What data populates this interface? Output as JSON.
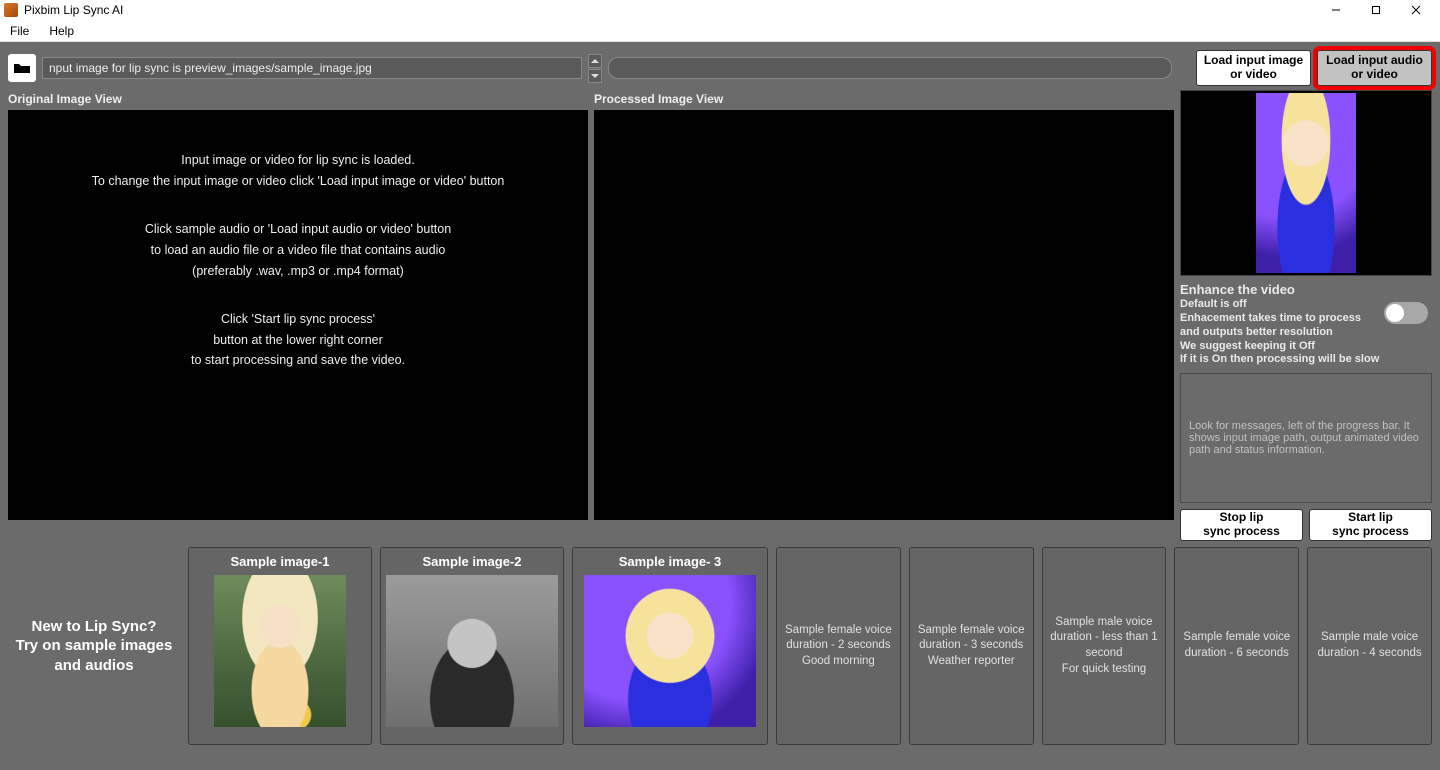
{
  "titlebar": {
    "title": "Pixbim Lip Sync AI"
  },
  "menu": {
    "file": "File",
    "help": "Help"
  },
  "path_input": {
    "value": "nput image for lip sync is preview_images/sample_image.jpg"
  },
  "buttons": {
    "load_image": "Load input image\nor video",
    "load_audio": "Load input audio\nor video",
    "stop": "Stop lip\nsync process",
    "start": "Start lip\nsync process"
  },
  "views": {
    "original_label": "Original Image View",
    "processed_label": "Processed Image View"
  },
  "instructions": {
    "l1": "Input image or video for lip sync is loaded.",
    "l2": "To change the input image or video click 'Load input image or video' button",
    "l3": "Click sample audio or 'Load input audio or video' button",
    "l4": "to load an audio file or a video file that contains audio",
    "l5": "(preferably .wav, .mp3 or .mp4 format)",
    "l6": "Click 'Start lip sync process'",
    "l7": "button at the lower right corner",
    "l8": "to start processing and save the video."
  },
  "enhance": {
    "title": "Enhance the video",
    "l1": "Default is off",
    "l2": "Enhacement takes time to process",
    "l3": "and outputs better resolution",
    "l4": "We suggest keeping it Off",
    "l5": "If it is On then processing will be slow"
  },
  "status": {
    "text": "Look for messages, left of the progress bar. It shows input image path, output animated video path and status information."
  },
  "samples_intro": "New to Lip Sync?\nTry on sample images and audios",
  "samples": {
    "img1": "Sample image-1",
    "img2": "Sample image-2",
    "img3": "Sample image- 3",
    "a1": "Sample female voice\nduration - 2 seconds\nGood morning",
    "a2": "Sample female voice\nduration - 3 seconds\nWeather reporter",
    "a3": "Sample male voice\nduration - less than 1 second\nFor quick testing",
    "a4": "Sample female voice\nduration - 6 seconds",
    "a5": "Sample male voice\nduration - 4 seconds"
  }
}
